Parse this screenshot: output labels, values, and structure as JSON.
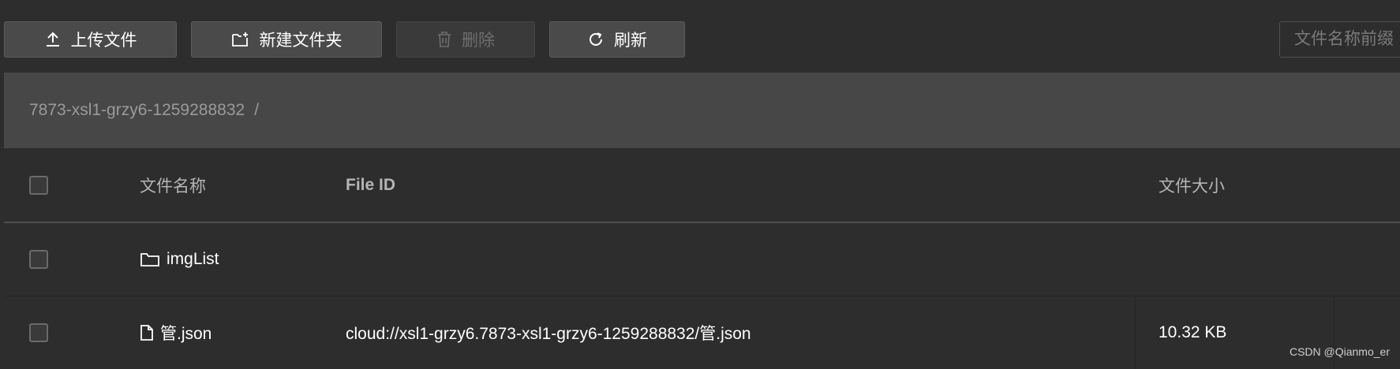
{
  "toolbar": {
    "upload_label": "上传文件",
    "new_folder_label": "新建文件夹",
    "delete_label": "删除",
    "refresh_label": "刷新",
    "search_placeholder": "文件名称前缀"
  },
  "breadcrumb": {
    "path": "7873-xsl1-grzy6-1259288832",
    "separator": "/"
  },
  "table": {
    "headers": {
      "name": "文件名称",
      "file_id": "File ID",
      "size": "文件大小"
    },
    "rows": [
      {
        "type": "folder",
        "icon": "folder-icon",
        "name": "imgList",
        "file_id": "",
        "size": ""
      },
      {
        "type": "file",
        "icon": "file-icon",
        "name": "管.json",
        "file_id": "cloud://xsl1-grzy6.7873-xsl1-grzy6-1259288832/管.json",
        "size": "10.32 KB"
      }
    ]
  },
  "watermark": "CSDN @Qianmo_er",
  "colors": {
    "background": "#2d2d2d",
    "button": "#4a4a4a",
    "breadcrumb_bar": "#474747",
    "header_text": "#b5b5b5"
  }
}
